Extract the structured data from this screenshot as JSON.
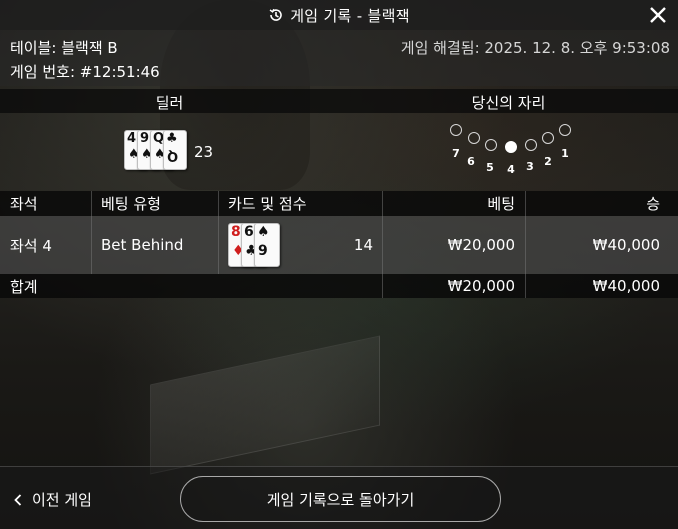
{
  "header": {
    "title": "게임 기록 - 블랙잭",
    "history_icon": "history-icon",
    "close_icon": "close-icon"
  },
  "info": {
    "table_label": "테이블: 블랙잭 B",
    "resolved_label": "게임 해결됨: 2025. 12. 8. 오후 9:53:08",
    "game_number_label": "게임 번호: #12:51:46"
  },
  "sections": {
    "dealer": "딜러",
    "your_seat": "당신의 자리"
  },
  "dealer": {
    "cards": [
      {
        "rank": "4",
        "suit": "♠",
        "color": "black"
      },
      {
        "rank": "9",
        "suit": "♠",
        "color": "black"
      },
      {
        "rank": "Q",
        "suit": "♠",
        "color": "black"
      },
      {
        "rank": "♣",
        "suit": "Q",
        "color": "black"
      }
    ],
    "score": "23"
  },
  "seats": {
    "numbers": [
      "7",
      "6",
      "5",
      "4",
      "3",
      "2",
      "1"
    ],
    "active_seat": "4"
  },
  "table": {
    "headers": {
      "seat": "좌석",
      "bet_type": "베팅 유형",
      "cards_score": "카드 및 점수",
      "bet": "베팅",
      "win": "승"
    },
    "rows": [
      {
        "seat": "좌석 4",
        "bet_type": "Bet Behind",
        "cards": [
          {
            "rank": "8",
            "suit": "♦",
            "color": "red"
          },
          {
            "rank": "6",
            "suit": "♣",
            "color": "black"
          },
          {
            "rank": "♠",
            "suit": "9",
            "color": "black"
          }
        ],
        "score": "14",
        "bet": "₩20,000",
        "win": "₩40,000"
      }
    ],
    "total": {
      "label": "합계",
      "bet": "₩20,000",
      "win": "₩40,000"
    }
  },
  "footer": {
    "prev_game": "이전 게임",
    "back_to_history": "게임 기록으로 돌아가기",
    "chevron_icon": "chevron-left-icon"
  },
  "colors": {
    "text": "#ffffff",
    "red_suit": "#d01e1e",
    "header_bg": "#1e1e1e"
  }
}
